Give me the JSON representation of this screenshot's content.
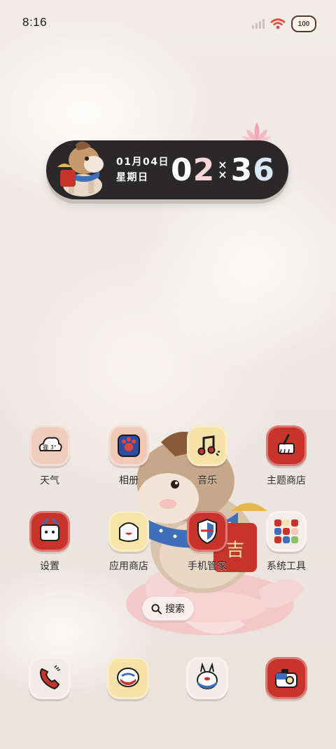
{
  "status_bar": {
    "time": "8:16",
    "battery": "100",
    "icons": [
      "signal-icon",
      "wifi-icon",
      "battery-icon"
    ],
    "colors": {
      "wifi": "#e24a3b",
      "battery_outline": "#5a3a2e"
    }
  },
  "widget": {
    "date": "01月04日",
    "weekday": "星期日",
    "hours": [
      "0",
      "2"
    ],
    "minutes": [
      "3",
      "6"
    ],
    "colors": {
      "background": "#2a2828"
    }
  },
  "apps": [
    {
      "label": "天气",
      "icon": "weather-cloud-icon",
      "icon_text": "霾 3°",
      "tile_color": "#efcdbd"
    },
    {
      "label": "相册",
      "icon": "gallery-icon",
      "tile_color": "#f0c9b8"
    },
    {
      "label": "音乐",
      "icon": "music-note-icon",
      "tile_color": "#f6e1a6"
    },
    {
      "label": "主题商店",
      "icon": "theme-brush-icon",
      "tile_color": "#c8342b"
    },
    {
      "label": "设置",
      "icon": "settings-gear-icon",
      "tile_color": "#c8342b"
    },
    {
      "label": "应用商店",
      "icon": "app-store-bag-icon",
      "tile_color": "#f6e4a8"
    },
    {
      "label": "手机管家",
      "icon": "phone-manager-shield-icon",
      "tile_color": "#c8342b"
    },
    {
      "label": "系统工具",
      "icon": "system-tools-folder-icon",
      "tile_color": "#f5eee9"
    }
  ],
  "search": {
    "label": "搜索",
    "icon": "search-icon"
  },
  "dock": [
    {
      "name": "phone",
      "icon": "phone-handset-icon",
      "tile_color": "#f3ece6"
    },
    {
      "name": "messages",
      "icon": "message-bubble-icon",
      "tile_color": "#f6e1a6"
    },
    {
      "name": "browser",
      "icon": "browser-bunny-icon",
      "tile_color": "#f3ece6"
    },
    {
      "name": "camera",
      "icon": "camera-icon",
      "tile_color": "#c8342b"
    }
  ]
}
